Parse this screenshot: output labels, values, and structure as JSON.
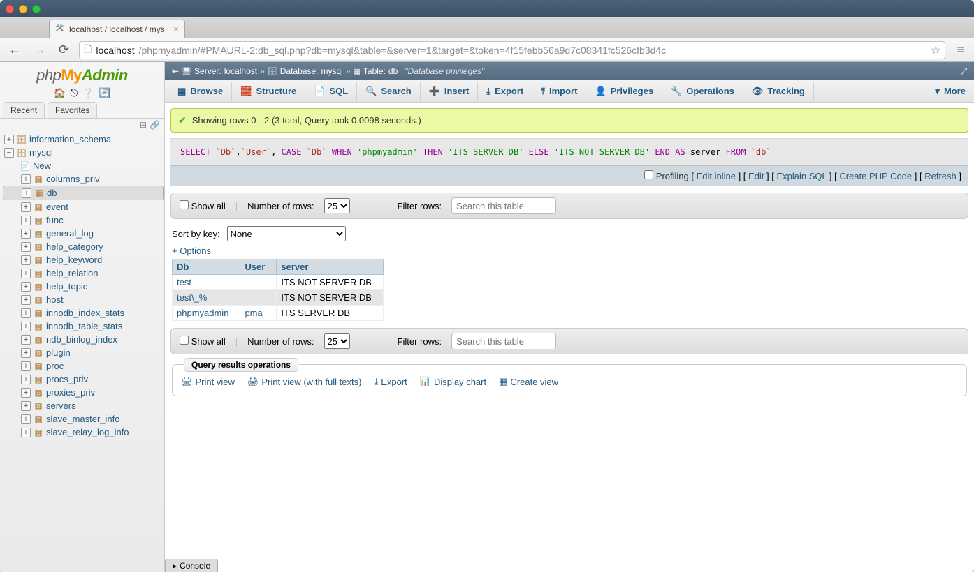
{
  "browser": {
    "tab_title": "localhost / localhost / mys",
    "url_host": "localhost",
    "url_rest": "/phpmyadmin/#PMAURL-2:db_sql.php?db=mysql&table=&server=1&target=&token=4f15febb56a9d7c08341fc526cfb3d4c"
  },
  "logo": {
    "p": "php",
    "my": "My",
    "admin": "Admin"
  },
  "side_tabs": {
    "recent": "Recent",
    "favorites": "Favorites"
  },
  "tree": {
    "db1": "information_schema",
    "db2": "mysql",
    "new": "New",
    "tables": [
      "columns_priv",
      "db",
      "event",
      "func",
      "general_log",
      "help_category",
      "help_keyword",
      "help_relation",
      "help_topic",
      "host",
      "innodb_index_stats",
      "innodb_table_stats",
      "ndb_binlog_index",
      "plugin",
      "proc",
      "procs_priv",
      "proxies_priv",
      "servers",
      "slave_master_info",
      "slave_relay_log_info"
    ],
    "selected": "db"
  },
  "breadcrumb": {
    "server_label": "Server:",
    "server_value": "localhost",
    "db_label": "Database:",
    "db_value": "mysql",
    "table_label": "Table:",
    "table_value": "db",
    "meta": "\"Database privileges\""
  },
  "maintabs": {
    "browse": "Browse",
    "structure": "Structure",
    "sql": "SQL",
    "search": "Search",
    "insert": "Insert",
    "export": "Export",
    "import": "Import",
    "privileges": "Privileges",
    "operations": "Operations",
    "tracking": "Tracking",
    "more": "More"
  },
  "success_msg": "Showing rows 0 - 2 (3 total, Query took 0.0098 seconds.)",
  "sql": {
    "select": "SELECT",
    "case": "CASE",
    "when": "WHEN",
    "then": "THEN",
    "else": "ELSE",
    "end": "END",
    "as": "AS",
    "from": "FROM",
    "f_db": "`Db`",
    "f_user": "`User`",
    "s_pma": "'phpmyadmin'",
    "s_yes": "'ITS SERVER DB'",
    "s_no": "'ITS NOT SERVER DB'",
    "alias": "server",
    "tbl": "`db`"
  },
  "profilebar": {
    "profiling": "Profiling",
    "edit_inline": "Edit inline",
    "edit": "Edit",
    "explain": "Explain SQL",
    "create_php": "Create PHP Code",
    "refresh": "Refresh"
  },
  "nav": {
    "show_all": "Show all",
    "num_rows_label": "Number of rows:",
    "num_rows_value": "25",
    "filter_label": "Filter rows:",
    "filter_placeholder": "Search this table"
  },
  "sort": {
    "label": "Sort by key:",
    "value": "None"
  },
  "options_link": "+ Options",
  "table": {
    "headers": {
      "db": "Db",
      "user": "User",
      "server": "server"
    },
    "rows": [
      {
        "db": "test",
        "user": "",
        "server": "ITS NOT SERVER DB"
      },
      {
        "db": "test\\_%",
        "user": "",
        "server": "ITS NOT SERVER DB"
      },
      {
        "db": "phpmyadmin",
        "user": "pma",
        "server": "ITS SERVER DB"
      }
    ]
  },
  "result_ops": {
    "legend": "Query results operations",
    "print": "Print view",
    "print_full": "Print view (with full texts)",
    "export": "Export",
    "chart": "Display chart",
    "create_view": "Create view"
  },
  "console": "Console"
}
